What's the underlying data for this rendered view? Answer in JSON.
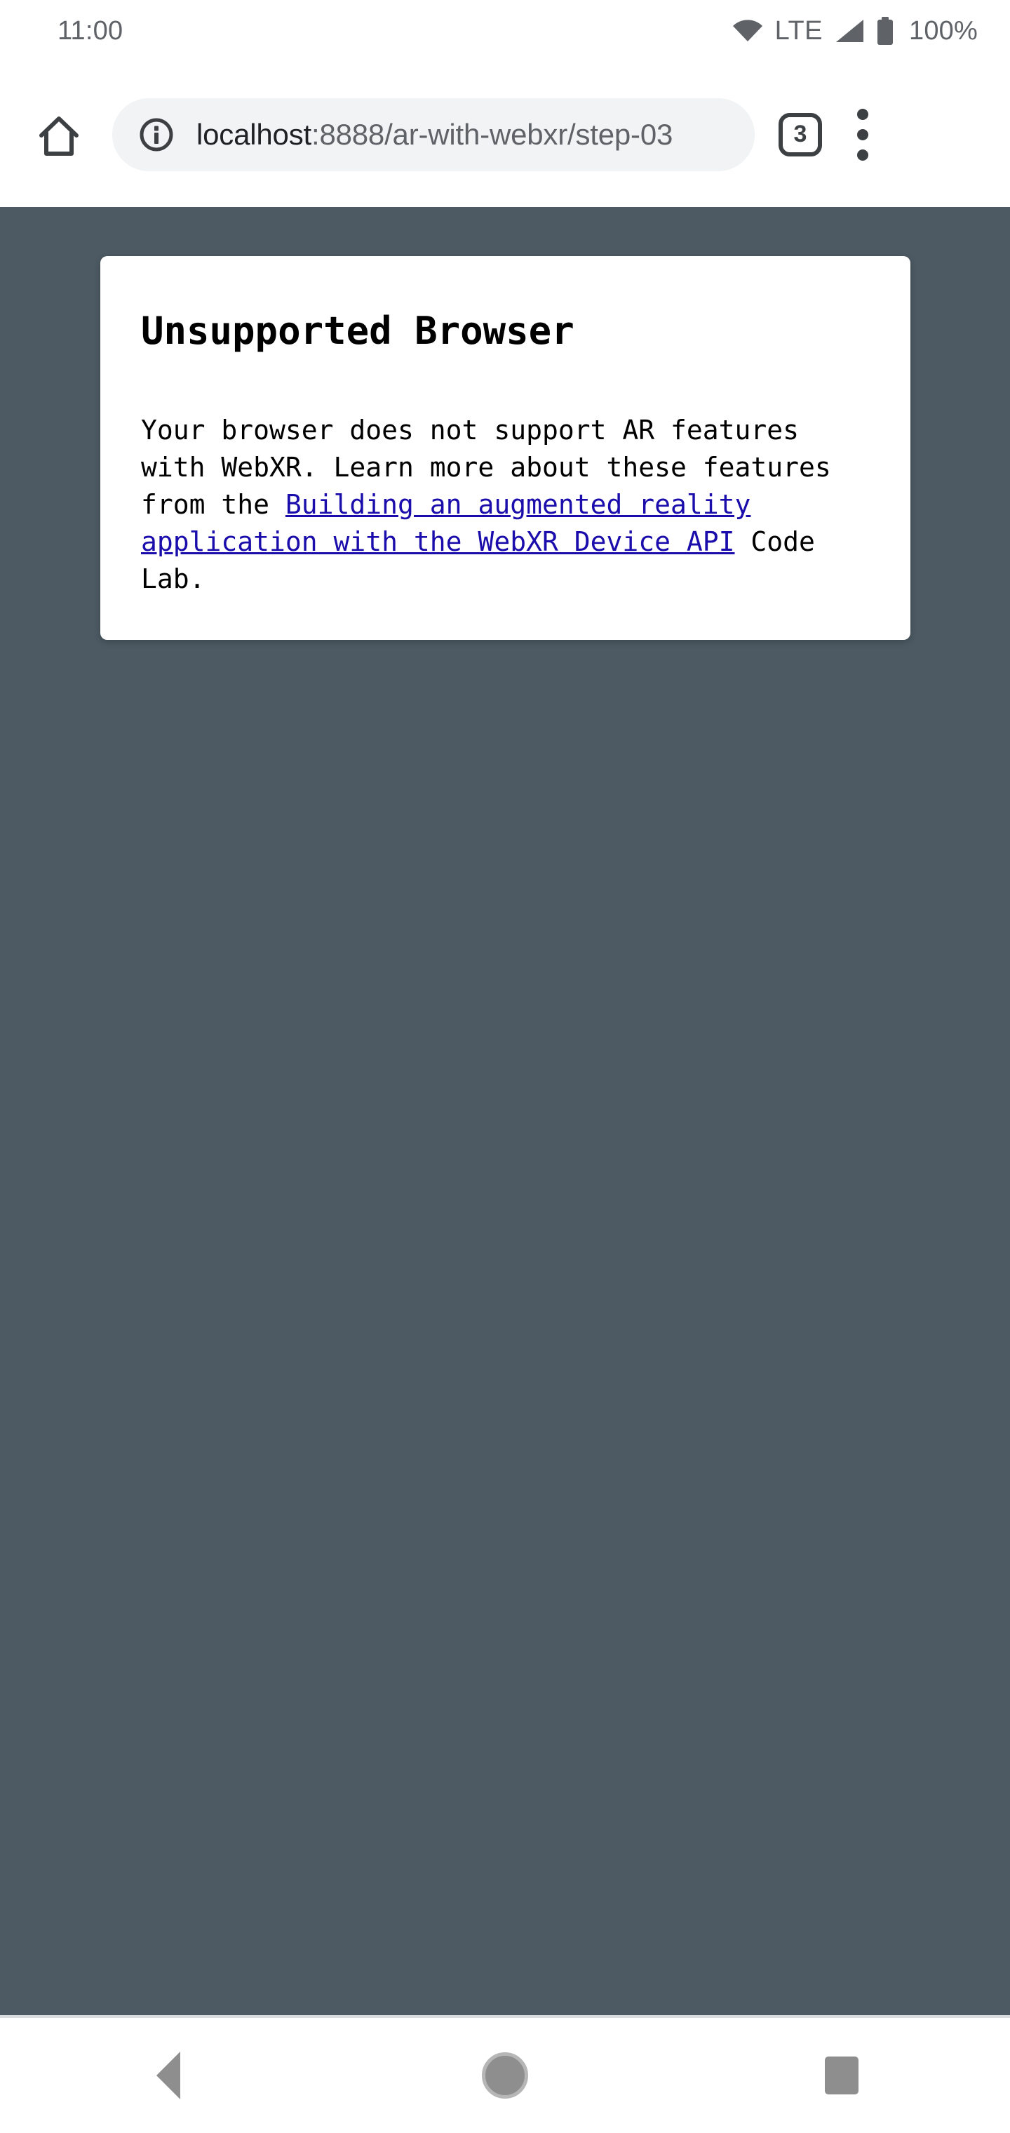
{
  "status_bar": {
    "clock": "11:00",
    "network_label": "LTE",
    "battery_percent": "100%",
    "icons": [
      "wifi-icon",
      "signal-icon",
      "battery-icon"
    ],
    "text_color": "#5f6368"
  },
  "browser": {
    "home_label": "home-icon",
    "site_info_label": "site-info-icon",
    "url_host": "localhost",
    "url_rest": ":8888/ar-with-webxr/step-03",
    "url_full": "localhost:8888/ar-with-webxr/step-03",
    "tab_count": "3",
    "overflow_label": "overflow-menu-icon",
    "omnibox_bg": "#f1f3f4"
  },
  "page": {
    "background_color": "#4d5a63",
    "card": {
      "title": "Unsupported Browser",
      "body_prefix": "Your browser does not support AR features with WebXR. Learn more about these features from the ",
      "link_text": "Building an augmented reality application with the WebXR Device API",
      "body_suffix": " Code Lab.",
      "link_color": "#1a0dab",
      "background_color": "#ffffff"
    }
  },
  "nav_bar": {
    "back_label": "back-button",
    "home_label": "home-button",
    "recents_label": "recents-button",
    "icon_color": "#8e8e8e"
  }
}
